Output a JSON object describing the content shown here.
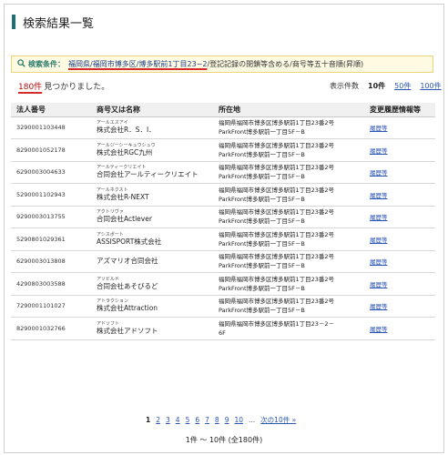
{
  "title": "検索結果一覧",
  "conditions": {
    "icon": "search-icon",
    "label": "検索条件：",
    "highlighted": "福岡県/福岡市博多区/博多駅前1丁目23−2",
    "rest": "/登記記録の閉鎖等含める/商号等五十音順(昇順)"
  },
  "result": {
    "count": "180件",
    "found_text": "見つかりました。"
  },
  "perpage": {
    "label": "表示件数",
    "current": "10件",
    "options": [
      "50件",
      "100件"
    ]
  },
  "table": {
    "headers": [
      "法人番号",
      "商号又は名称",
      "所在地",
      "変更履歴情報等"
    ],
    "rows": [
      {
        "number": "3290001103448",
        "kana": "アールエスアイ",
        "name": "株式会社R．S．I．",
        "addr1": "福岡県福岡市博多区博多駅前1丁目23番2号",
        "addr2": "ParkFront博多駅前一丁目5F－B",
        "history": "履歴等"
      },
      {
        "number": "8290001052178",
        "kana": "アールジーシーキュウシュウ",
        "name": "株式会社RGC九州",
        "addr1": "福岡県福岡市博多区博多駅前1丁目23番2号",
        "addr2": "ParkFront博多駅前一丁目5F－B",
        "history": "履歴等"
      },
      {
        "number": "6290003004633",
        "kana": "アールティークリエイト",
        "name": "合同会社アールティークリエイト",
        "addr1": "福岡県福岡市博多区博多駅前1丁目23番2号",
        "addr2": "ParkFront博多駅前一丁目5F－B",
        "history": "履歴等"
      },
      {
        "number": "5290001102943",
        "kana": "アールネクスト",
        "name": "株式会社R-NEXT",
        "addr1": "福岡県福岡市博多区博多駅前1丁目23番2号",
        "addr2": "ParkFront博多駅前一丁目5F－B",
        "history": "履歴等"
      },
      {
        "number": "9290003013755",
        "kana": "アクトリヴァ",
        "name": "合同会社Actlever",
        "addr1": "福岡県福岡市博多区博多駅前1丁目23番2号",
        "addr2": "ParkFront博多駅前一丁目5F－B",
        "history": "履歴等"
      },
      {
        "number": "5290801029361",
        "kana": "アシスポート",
        "name": "ASSISPORT株式会社",
        "addr1": "福岡県福岡市博多区博多駅前1丁目23番2号",
        "addr2": "ParkFront博多駅前一丁目5F－B",
        "history": "履歴等"
      },
      {
        "number": "6290003013808",
        "kana": "",
        "name": "アズマリオ合同会社",
        "addr1": "福岡県福岡市博多区博多駅前1丁目23番2号",
        "addr2": "ParkFront博多駅前一丁目5F－B",
        "history": "履歴等"
      },
      {
        "number": "4290803003588",
        "kana": "アソビルド",
        "name": "合同会社あそびるど",
        "addr1": "福岡県福岡市博多区博多駅前1丁目23番2号",
        "addr2": "ParkFront博多駅前一丁目5F－B",
        "history": "履歴等"
      },
      {
        "number": "7290001101027",
        "kana": "アトラクション",
        "name": "株式会社Attraction",
        "addr1": "福岡県福岡市博多区博多駅前1丁目23番2号",
        "addr2": "ParkFront博多駅前一丁目5F－B",
        "history": "履歴等"
      },
      {
        "number": "8290001032766",
        "kana": "アドソフト",
        "name": "株式会社アドソフト",
        "addr1": "福岡県福岡市博多区博多駅前1丁目23－2－",
        "addr2": "6F",
        "history": "履歴等"
      }
    ]
  },
  "pagination": {
    "current": "1",
    "pages": [
      "2",
      "3",
      "4",
      "5",
      "6",
      "7",
      "8",
      "9",
      "10"
    ],
    "ellipsis": "...",
    "next": "次の10件 »"
  },
  "summary": "1件 ～ 10件 (全180件)"
}
